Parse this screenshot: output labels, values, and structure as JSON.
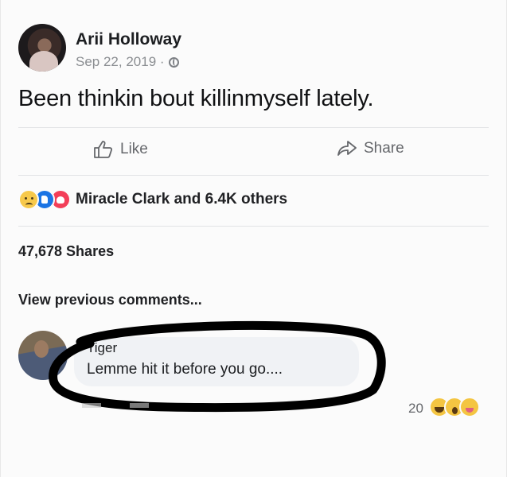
{
  "post": {
    "author": "Arii Holloway",
    "date": "Sep 22, 2019 ·",
    "privacy_icon": "globe-icon",
    "text": "Been thinkin bout killinmyself lately."
  },
  "actions": {
    "like_label": "Like",
    "share_label": "Share"
  },
  "reactions": {
    "icons": [
      "sad-icon",
      "like-icon",
      "love-icon"
    ],
    "summary": "Miracle Clark and 6.4K others"
  },
  "shares": {
    "count_label": "47,678 Shares"
  },
  "comments": {
    "view_previous": "View previous comments...",
    "items": [
      {
        "author": "Tiger",
        "text": "Lemme hit it before you go....",
        "reaction_count": "20",
        "reaction_icons": [
          "laugh-icon",
          "wow-icon",
          "tongue-icon"
        ]
      }
    ]
  },
  "colors": {
    "accent_blue": "#1b74e4",
    "love_red": "#f33e58",
    "muted_text": "#65676b",
    "marker_black": "#000000"
  }
}
